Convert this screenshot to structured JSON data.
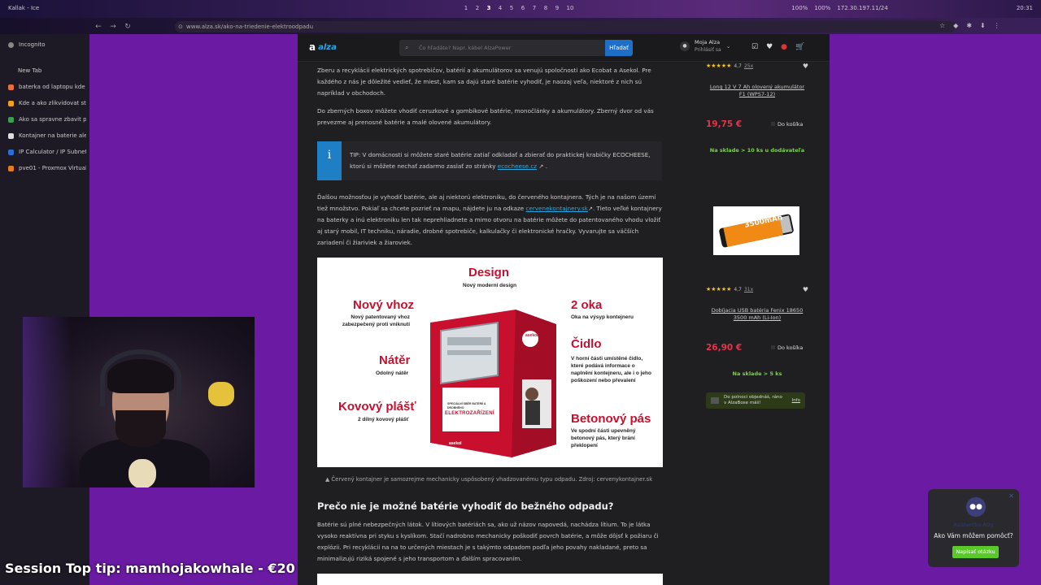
{
  "system": {
    "window_title": "Kallak - Ice",
    "workspaces": [
      "1",
      "2",
      "3",
      "4",
      "5",
      "6",
      "7",
      "8",
      "9",
      "10"
    ],
    "active_workspace": "3",
    "tray": [
      "100%",
      "100%",
      "172.30.197.11/24",
      "20:31"
    ]
  },
  "browser": {
    "url": "www.alza.sk/ako-na-triedenie-elektroodpadu",
    "sidebar": {
      "incognito_label": "Incognito",
      "new_tab_label": "New Tab",
      "tabs": [
        {
          "label": "baterka od laptopu kde v",
          "color": "#e8703a"
        },
        {
          "label": "Kde a ako zlikvidovat sta",
          "color": "#f0a020"
        },
        {
          "label": "Ako sa spravne zbavit po",
          "color": "#3aa050"
        },
        {
          "label": "Kontajner na baterie alet",
          "color": "#dddddd"
        },
        {
          "label": "IP Calculator / IP Subnet",
          "color": "#2a6fd8"
        },
        {
          "label": "pve01 - Proxmox Virtual",
          "color": "#e87a20"
        }
      ]
    }
  },
  "site": {
    "logo": "a",
    "logo_sub": "alza",
    "search_placeholder": "Čo hľadáte? Napr. kábel AlzaPower",
    "search_button": "Hľadať",
    "account_name": "Moja Alza",
    "account_sub": "Prihlásiť sa"
  },
  "article": {
    "p1": "Zberu a recyklácii elektrických spotrebičov, batérií a akumulátorov sa venujú spoločnosti ako Ecobat a Asekol. Pre každého z nás je dôležité vedieť, že miest, kam sa dajú staré batérie vyhodiť, je naozaj veľa, niektoré z nich sú napríklad v obchodoch.",
    "p2": "Do zberných boxov môžete vhodiť ceruzkové a gombíkové batérie, monočlánky a akumulátory. Zberný dvor od vás prevezme aj prenosné batérie a malé olovené akumulátory.",
    "tip_icon": "i",
    "tip_text": "TIP: V domácnosti si môžete staré batérie zatiaľ odkladať a zbierať do praktickej krabičky ECOCHEESE, ktorú si môžete nechať zadarmo zaslať zo stránky",
    "tip_link": "ecocheese.cz",
    "p3_a": "Ďalšou možnosťou je vyhodiť batérie, ale aj niektorú elektroniku, do červeného kontajnera. Tých je na našom území tiež množstvo. Pokiaľ sa chcete pozrieť na mapu, nájdete ju na odkaze",
    "p3_link": "cervenekontajnery.sk",
    "p3_b": ". Tieto veľké kontajnery na baterky a inú elektroniku len tak neprehliadnete a mimo otvoru na batérie môžete do patentovaného vhodu vložiť aj starý mobil, IT techniku, náradie, drobné spotrebiče, kalkulačky či elektronické hračky. Vyvarujte sa väčších zariadení či žiariviek a žiaroviek.",
    "infographic": {
      "design_title": "Design",
      "design_desc": "Nový moderní design",
      "vhoz_title": "Nový vhoz",
      "vhoz_desc": "Nový patentovaný vhoz zabezpečený proti vniknutí",
      "oka_title": "2 oka",
      "oka_desc": "Oka na výsyp kontejneru",
      "cidlo_title": "Čidlo",
      "cidlo_desc": "V horní části umístěné čidlo, které podává informace o naplnění kontejneru, ale i o jeho poškození nebo převalení",
      "nater_title": "Nátěr",
      "nater_desc": "Odolný nátěr",
      "plast_title": "Kovový plášť",
      "plast_desc": "2 dílný kovový plášť",
      "pas_title": "Betonový pás",
      "pas_desc": "Ve spodní části upevněný betonový pás, který brání překlopení",
      "container_big": "ELEKTROZAŘÍZENÍ",
      "container_small": "SPECIÁLNÍ SBĚR BATERIÍ A DROBNÉHO",
      "brand": "asekol"
    },
    "caption": "▲  Červený kontajner je samozrejme mechanicky uspôsobený vhadzovanému typu odpadu. Zdroj: cervenykontajner.sk",
    "h2": "Prečo nie je možné batérie vyhodiť do bežného odpadu?",
    "p4": "Batérie sú plné nebezpečných látok. V lítiových batériách sa, ako už názov napovedá, nachádza lítium. To je látka vysoko reaktívna pri styku s kyslíkom. Stačí nadrobno mechanicky poškodiť povrch batérie, a môže dôjsť k požiaru či explózii. Pri recyklácii na na to určených miestach je s takýmto odpadom podľa jeho povahy nakladané, preto sa minimalizujú riziká spojené s jeho transportom a ďalším spracovaním."
  },
  "products": [
    {
      "stars": "★★★★★",
      "rating": "4,7",
      "count": "25x",
      "name": "Long 12 V 7 Ah olovený akumulátor F1 (WPS7-12)",
      "price": "19,75 €",
      "cart": "Do košíka",
      "stock": "Na sklade > 10 ks u dodávateľa"
    },
    {
      "stars": "★★★★★",
      "rating": "4,7",
      "count": "31x",
      "name": "Dobíjacia USB batéria Fenix 18650 3500 mAh (Li-Ion)",
      "price": "26,90 €",
      "cart": "Do košíka",
      "stock": "Na sklade > 5 ks",
      "promo": "Do polnoci objednáš, ráno v AlzaBoxe máš!",
      "promo_info": "Info",
      "image_label": "3500mAh"
    }
  ],
  "chat": {
    "name": "Asistentka Alzy",
    "question": "Ako Vám môžem pomôcť?",
    "button": "Napísať otázku"
  },
  "stream": {
    "tip_text": "Session Top tip: mamhojakowhale - €20"
  },
  "colors": {
    "page_purple": "#6b1ba3",
    "content_bg": "#1f1f22",
    "price_red": "#e8334a",
    "stock_green": "#7bd34a",
    "alza_blue": "#1d6fc8",
    "infographic_red": "#c8102e"
  }
}
